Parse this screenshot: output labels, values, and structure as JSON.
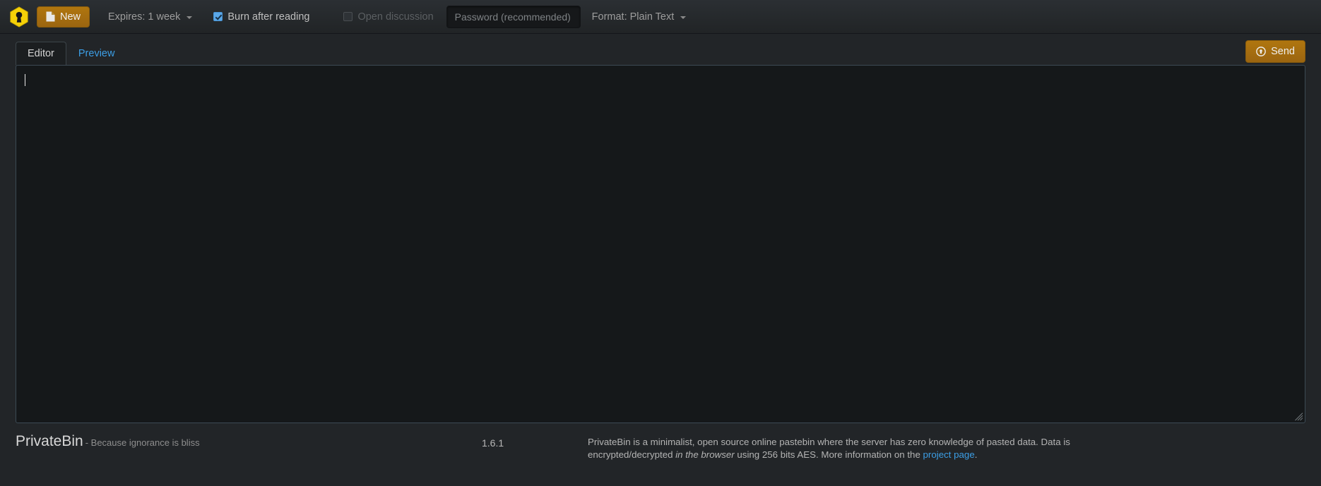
{
  "colors": {
    "accent_amber": "#b0760f",
    "link_blue": "#3c9ee5",
    "checkbox_blue": "#5aa7e8",
    "logo_yellow": "#f5d108",
    "page_bg": "#222528",
    "editor_bg": "#15181a"
  },
  "navbar": {
    "logo_name": "privatebin-logo-icon",
    "new_button": {
      "label": "New",
      "icon": "file-icon"
    },
    "expires": {
      "label": "Expires: 1 week",
      "icon": "chevron-down-icon"
    },
    "burn_after_reading": {
      "label": "Burn after reading",
      "checked": true
    },
    "open_discussion": {
      "label": "Open discussion",
      "checked": false,
      "disabled": true
    },
    "password": {
      "value": "",
      "placeholder": "Password (recommended)"
    },
    "format": {
      "label": "Format: Plain Text",
      "icon": "chevron-down-icon"
    }
  },
  "main": {
    "tabs": [
      {
        "label": "Editor",
        "active": true
      },
      {
        "label": "Preview",
        "active": false
      }
    ],
    "send_button": {
      "label": "Send",
      "icon": "upload-circle-icon"
    },
    "editor": {
      "value": "",
      "placeholder": ""
    }
  },
  "footer": {
    "brand_name": "PrivateBin",
    "slogan": "- Because ignorance is bliss",
    "version": "1.6.1",
    "description_part1": "PrivateBin is a minimalist, open source online pastebin where the server has zero knowledge of pasted data. Data is encrypted/decrypted ",
    "description_em1": "in the browser",
    "description_part2": " using 256 bits AES. More information on the ",
    "description_link": "project page",
    "description_part3": "."
  }
}
